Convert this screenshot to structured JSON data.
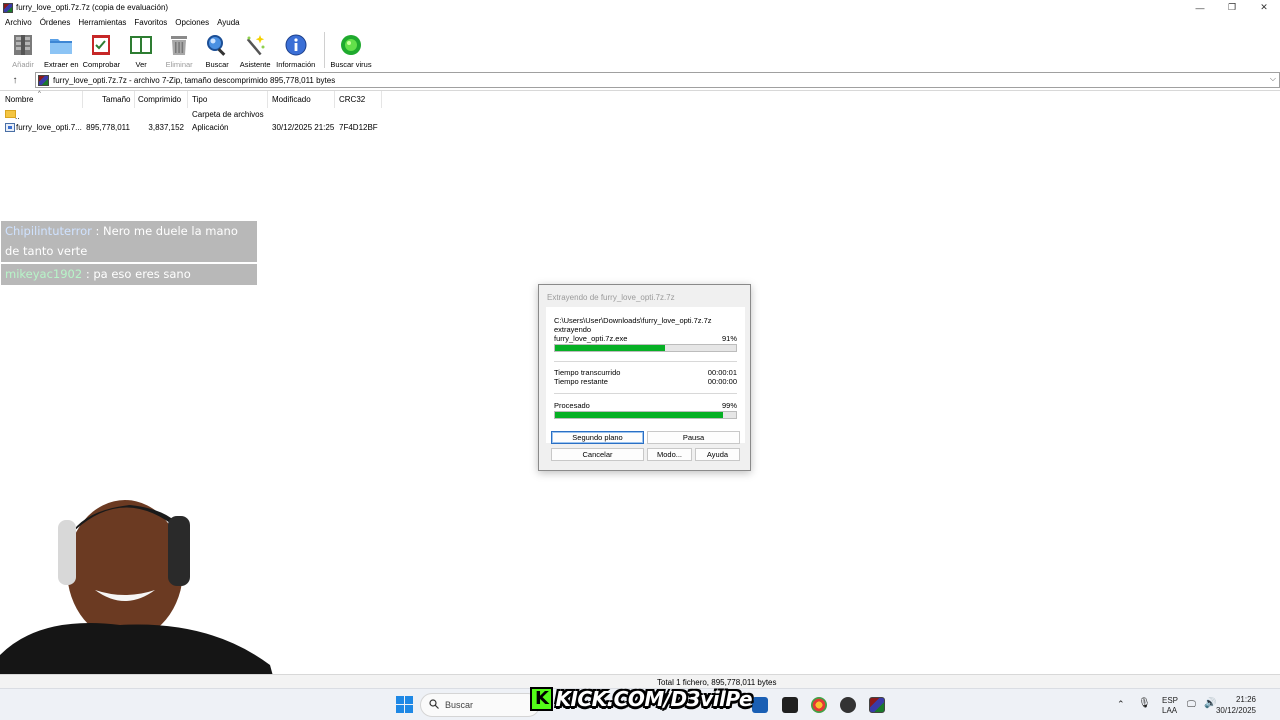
{
  "window": {
    "title": "furry_love_opti.7z.7z (copia de evaluación)",
    "minimize": "—",
    "restore": "❐",
    "close": "✕"
  },
  "menu": [
    "Archivo",
    "Órdenes",
    "Herramientas",
    "Favoritos",
    "Opciones",
    "Ayuda"
  ],
  "toolbar": [
    {
      "label": "Añadir",
      "icon": "add-archive-icon",
      "disabled": true
    },
    {
      "label": "Extraer en",
      "icon": "extract-folder-icon",
      "disabled": false
    },
    {
      "label": "Comprobar",
      "icon": "test-archive-icon",
      "disabled": false
    },
    {
      "label": "Ver",
      "icon": "view-book-icon",
      "disabled": false
    },
    {
      "label": "Eliminar",
      "icon": "trash-icon",
      "disabled": true
    },
    {
      "label": "Buscar",
      "icon": "magnifier-icon",
      "disabled": false
    },
    {
      "label": "Asistente",
      "icon": "wizard-wand-icon",
      "disabled": false
    },
    {
      "label": "Información",
      "icon": "info-icon",
      "disabled": false
    },
    {
      "label": "Buscar virus",
      "icon": "virus-scan-icon",
      "disabled": false
    }
  ],
  "address": {
    "up": "↑",
    "text": "furry_love_opti.7z.7z - archivo 7-Zip, tamaño descomprimido 895,778,011 bytes",
    "dropdown": "⌵"
  },
  "columns": [
    "Nombre",
    "Tamaño",
    "Comprimido",
    "Tipo",
    "Modificado",
    "CRC32"
  ],
  "sort_indicator": "^",
  "rows": [
    {
      "name": "..",
      "size": "",
      "packed": "",
      "type": "Carpeta de archivos",
      "modified": "",
      "crc": ""
    },
    {
      "name": "furry_love_opti.7...",
      "size": "895,778,011",
      "packed": "3,837,152",
      "type": "Aplicación",
      "modified": "30/12/2025 21:25",
      "crc": "7F4D12BF"
    }
  ],
  "chat": [
    {
      "user": "Chipilintuterror",
      "message": " : Nero me duele la mano de tanto verte"
    },
    {
      "user": "mikeyac1902",
      "message": " : pa eso eres sano"
    }
  ],
  "dialog": {
    "title": "Extrayendo de furry_love_opti.7z.7z",
    "path": "C:\\Users\\User\\Downloads\\furry_love_opti.7z.7z",
    "action": "extrayendo",
    "file": "furry_love_opti.7z.exe",
    "file_percent_text": "91%",
    "file_progress": 0.61,
    "elapsed_label": "Tiempo transcurrido",
    "elapsed_value": "00:00:01",
    "remaining_label": "Tiempo restante",
    "remaining_value": "00:00:00",
    "processed_label": "Procesado",
    "processed_percent_text": "99%",
    "processed_progress": 0.93,
    "buttons": {
      "background": "Segundo plano",
      "pause": "Pausa",
      "cancel": "Cancelar",
      "mode": "Modo...",
      "help": "Ayuda"
    }
  },
  "status": "Total 1 fichero, 895,778,011 bytes",
  "taskbar": {
    "search_placeholder": "Buscar",
    "overlay_text": "KICK.COM/D3vilPe",
    "overlay_badge": "K",
    "lang": "ESP",
    "region": "LAA",
    "time": "21:26",
    "date": "30/12/2025"
  },
  "colors": {
    "progress": "#06b025",
    "kick_green": "#53fc18"
  }
}
